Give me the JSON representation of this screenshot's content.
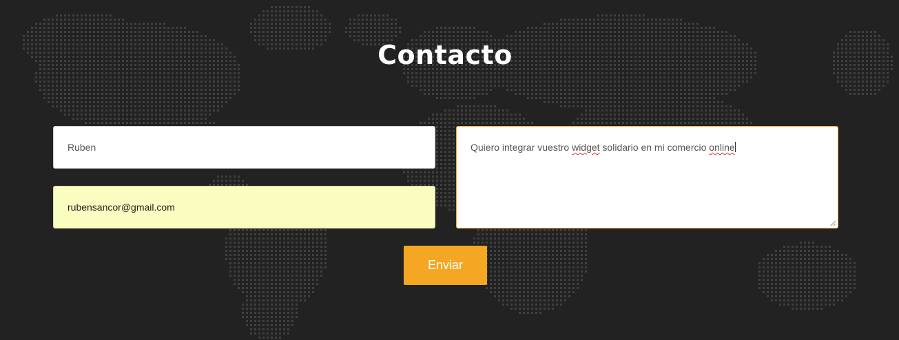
{
  "page": {
    "title": "Contacto"
  },
  "form": {
    "name_value": "Ruben",
    "email_value": "rubensancor@gmail.com",
    "message_words": {
      "part1": "Quiero integrar vuestro ",
      "part2": "widget",
      "part3": " solidario en mi comercio ",
      "part4": "online"
    },
    "submit_label": "Enviar"
  },
  "colors": {
    "background": "#222222",
    "accent": "#f5a623",
    "autofill": "#fafcc0",
    "map_dots": "#5a5a5a"
  }
}
